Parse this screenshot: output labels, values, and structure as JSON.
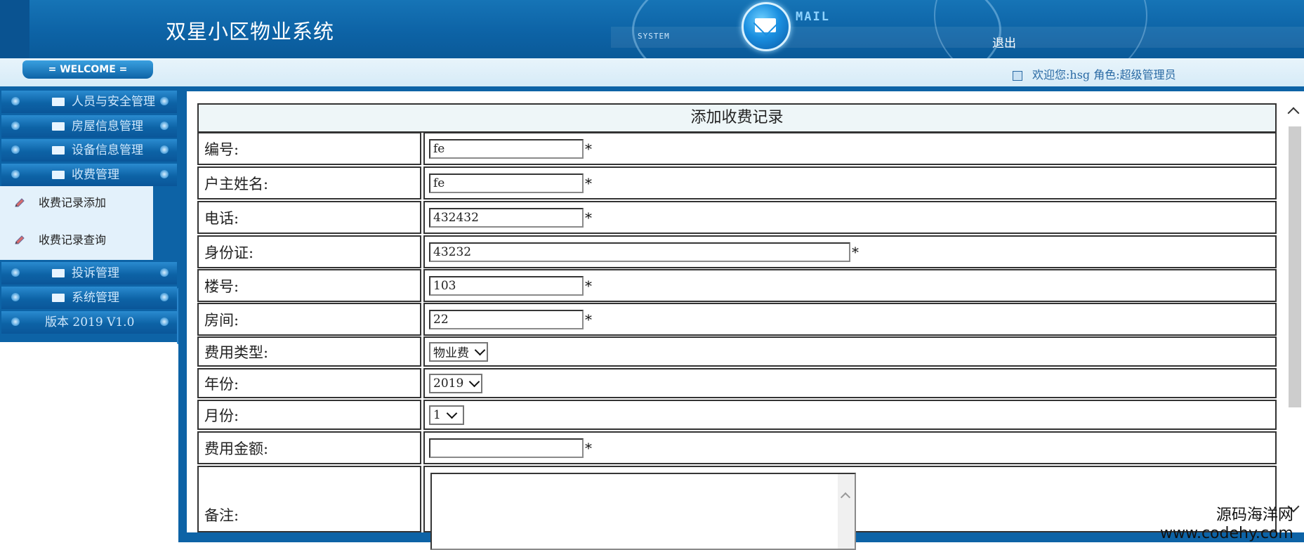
{
  "header": {
    "title": "双星小区物业系统",
    "system_tag": "SYSTEM",
    "mail_tag": "MAIL",
    "logout": "退出"
  },
  "welcome": {
    "tab": "= WELCOME =",
    "user_text": "欢迎您:hsg 角色:超级管理员"
  },
  "sidebar": {
    "items": [
      {
        "label": "人员与安全管理"
      },
      {
        "label": "房屋信息管理"
      },
      {
        "label": "设备信息管理"
      },
      {
        "label": "收费管理"
      },
      {
        "label": "投诉管理"
      },
      {
        "label": "系统管理"
      },
      {
        "label": "版本 2019 V1.0"
      }
    ],
    "submenu": [
      {
        "label": "收费记录添加"
      },
      {
        "label": "收费记录查询"
      }
    ]
  },
  "form": {
    "title": "添加收费记录",
    "fields": {
      "id": {
        "label": "编号:",
        "value": "fe"
      },
      "owner": {
        "label": "户主姓名:",
        "value": "fe"
      },
      "phone": {
        "label": "电话:",
        "value": "432432"
      },
      "idcard": {
        "label": "身份证:",
        "value": "43232"
      },
      "building": {
        "label": "楼号:",
        "value": "103"
      },
      "room": {
        "label": "房间:",
        "value": "22"
      },
      "fee_type": {
        "label": "费用类型:",
        "value": "物业费"
      },
      "year": {
        "label": "年份:",
        "value": "2019"
      },
      "month": {
        "label": "月份:",
        "value": "1"
      },
      "amount": {
        "label": "费用金额:",
        "value": ""
      },
      "remark": {
        "label": "备注:",
        "value": ""
      }
    },
    "required_mark": "*"
  },
  "watermark": {
    "line1": "源码海洋网",
    "line2": "www.codehy.com"
  }
}
